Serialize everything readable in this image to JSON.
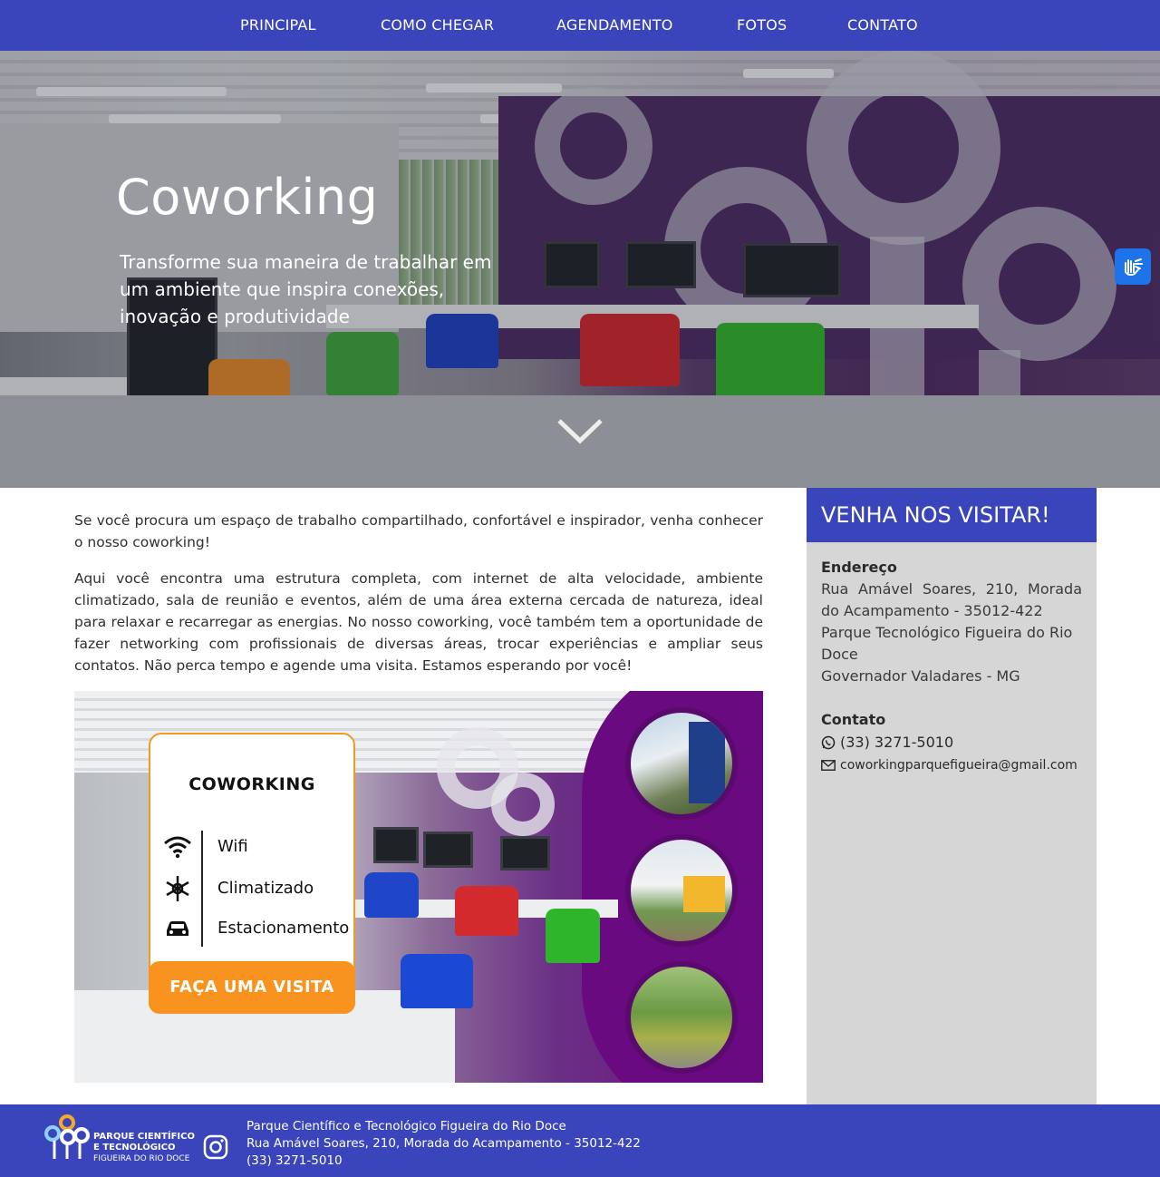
{
  "nav": {
    "items": [
      {
        "label": "PRINCIPAL"
      },
      {
        "label": "COMO CHEGAR"
      },
      {
        "label": "AGENDAMENTO"
      },
      {
        "label": "FOTOS"
      },
      {
        "label": "CONTATO"
      }
    ]
  },
  "hero": {
    "title": "Coworking",
    "subtitle": "Transforme sua maneira de trabalhar em um ambiente que inspira conexões, inovação e produtividade",
    "scroll_icon": "chevron-down-icon",
    "accessibility_icon": "sign-language-icon"
  },
  "content": {
    "paragraphs": [
      "Se você procura um espaço de trabalho compartilhado, confortável e inspirador, venha conhecer o nosso coworking!",
      "Aqui você encontra uma estrutura completa, com internet de alta velocidade, ambiente climatizado, sala de reunião e eventos, além de uma área externa cercada de natureza, ideal para relaxar e recarregar as energias. No nosso coworking, você também tem a oportunidade de fazer networking com profissionais de diversas áreas, trocar experiências e ampliar seus contatos. Não perca tempo e agende uma visita. Estamos esperando por você!"
    ]
  },
  "promo": {
    "title": "COWORKING",
    "features": [
      {
        "label": "Wifi",
        "icon": "wifi-icon"
      },
      {
        "label": "Climatizado",
        "icon": "snowflake-icon"
      },
      {
        "label": "Estacionamento",
        "icon": "car-icon"
      }
    ],
    "cta": "FAÇA UMA VISITA"
  },
  "sidebar": {
    "heading": "VENHA NOS VISITAR!",
    "address_label": "Endereço",
    "address_lines": [
      "Rua Amável Soares, 210, Morada do Acampamento - 35012-422",
      "Parque Tecnológico Figueira do Rio Doce",
      "Governador Valadares - MG"
    ],
    "contact_label": "Contato",
    "phone": "(33) 3271-5010",
    "email": "coworkingparquefigueira@gmail.com"
  },
  "footer": {
    "logo_line1": "PARQUE CIENTÍFICO",
    "logo_line2": "E TECNOLÓGICO",
    "logo_line3": "FIGUEIRA DO RIO DOCE",
    "lines": [
      "Parque Científico e Tecnológico Figueira do Rio Doce",
      "Rua Amável Soares, 210, Morada do Acampamento - 35012-422",
      "(33) 3271-5010"
    ]
  },
  "colors": {
    "primary": "#3a45bb",
    "sidebar_bg": "#d6d6d6",
    "cta_orange": "#f7931e",
    "promo_purple": "#6a0a80",
    "accessibility_blue": "#1e73e8"
  }
}
